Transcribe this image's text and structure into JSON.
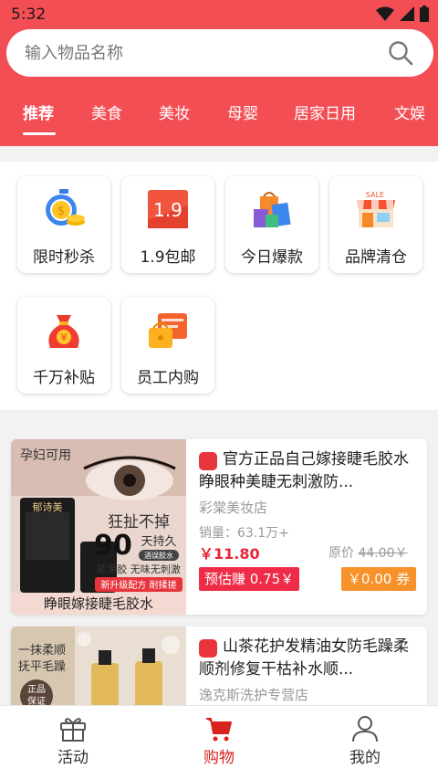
{
  "status_bar": {
    "time": "5:32"
  },
  "search": {
    "placeholder": "输入物品名称"
  },
  "tabs": [
    {
      "label": "推荐",
      "active": true
    },
    {
      "label": "美食"
    },
    {
      "label": "美妆"
    },
    {
      "label": "母婴"
    },
    {
      "label": "居家日用"
    },
    {
      "label": "文娱"
    }
  ],
  "categories": [
    {
      "label": "限时秒杀",
      "icon": "stopwatch-coin-icon"
    },
    {
      "label": "1.9包邮",
      "icon": "price-tag-icon",
      "icon_text": "1.9"
    },
    {
      "label": "今日爆款",
      "icon": "shopping-bags-icon"
    },
    {
      "label": "品牌清仓",
      "icon": "sale-store-icon",
      "icon_text": "SALE"
    },
    {
      "label": "千万补贴",
      "icon": "money-bag-icon",
      "icon_text": "¥"
    },
    {
      "label": "员工内购",
      "icon": "wallet-icon"
    }
  ],
  "products": [
    {
      "image_texts": {
        "top": "孕妇可用",
        "headline": "狂扯不掉",
        "big_number": "90",
        "days": "天持久",
        "pill": "酒误胶水",
        "features": "软黑胶 无味无刺激",
        "formula": "新升级配方 耐揉搓",
        "bottom": "睁眼嫁接睫毛胶水",
        "bottle_brand": "郁诗美"
      },
      "title": "官方正品自己嫁接睫毛胶水睁眼种美睫无刺激防...",
      "shop": "彩棠美妆店",
      "sales": "销量：63.1万+",
      "price": "￥11.80",
      "original_label": "原价",
      "original_price": "44.00￥",
      "earn": "预估赚 0.75￥",
      "coupon": "￥0.00 券"
    },
    {
      "image_texts": {
        "line1": "一抹柔顺",
        "line2": "抚平毛躁",
        "badge1": "正品",
        "badge2": "保证"
      },
      "title": "山茶花护发精油女防毛躁柔顺剂修复干枯补水顺...",
      "shop": "逸克斯洗护专营店"
    }
  ],
  "bottom_nav": [
    {
      "label": "活动",
      "icon": "gift-icon"
    },
    {
      "label": "购物",
      "icon": "cart-icon",
      "active": true
    },
    {
      "label": "我的",
      "icon": "user-icon"
    }
  ],
  "colors": {
    "brand": "#f44e55",
    "price": "#e8263a",
    "earn": "#ef2c47",
    "coupon": "#f7912a",
    "nav_active": "#d8241f"
  }
}
